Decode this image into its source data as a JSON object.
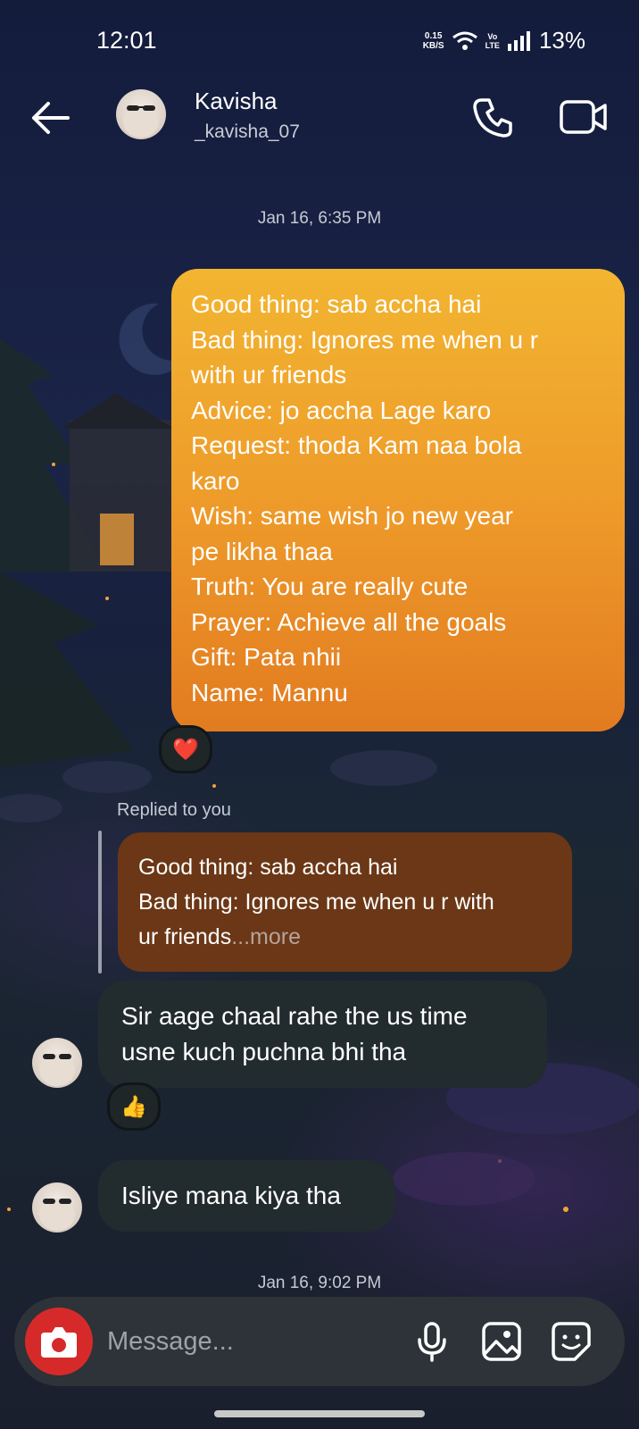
{
  "status_bar": {
    "time": "12:01",
    "net_speed_value": "0.15",
    "net_speed_unit": "KB/S",
    "volte_top": "Vo",
    "volte_bottom": "LTE",
    "battery": "13%"
  },
  "header": {
    "name": "Kavisha",
    "username": "_kavisha_07"
  },
  "messages": {
    "timestamp_1": "Jan 16, 6:35 PM",
    "sent_lines": [
      "Good thing: sab accha hai",
      "Bad thing: Ignores me when u r",
      "with ur friends",
      "Advice: jo accha Lage karo",
      "Request: thoda Kam naa bola",
      "karo",
      "Wish: same wish jo new year",
      "pe likha thaa",
      "Truth: You are really cute",
      "Prayer: Achieve all the goals",
      "Gift: Pata nhii",
      "Name: Mannu"
    ],
    "sent_reaction": "❤️",
    "replied_label": "Replied to you",
    "reply_quote_lines": [
      "Good thing: sab accha hai",
      "Bad thing: Ignores me when u r with",
      "ur friends"
    ],
    "reply_more": "...more",
    "received_1_lines": [
      "Sir aage chaal rahe the us time",
      "usne kuch puchna bhi tha"
    ],
    "received_1_reaction": "👍",
    "received_2": "Isliye mana kiya tha",
    "timestamp_2": "Jan 16, 9:02 PM"
  },
  "composer": {
    "placeholder": "Message..."
  },
  "colors": {
    "sent_bubble_top": "#f2b531",
    "sent_bubble_bottom": "#e27b20",
    "reply_bubble": "#6b3716",
    "received_bubble": "#222b2e",
    "camera_button": "#d62a2a"
  },
  "icons": [
    "back-arrow-icon",
    "phone-icon",
    "video-camera-icon",
    "camera-icon",
    "microphone-icon",
    "gallery-icon",
    "sticker-icon",
    "wifi-icon",
    "signal-icon"
  ]
}
